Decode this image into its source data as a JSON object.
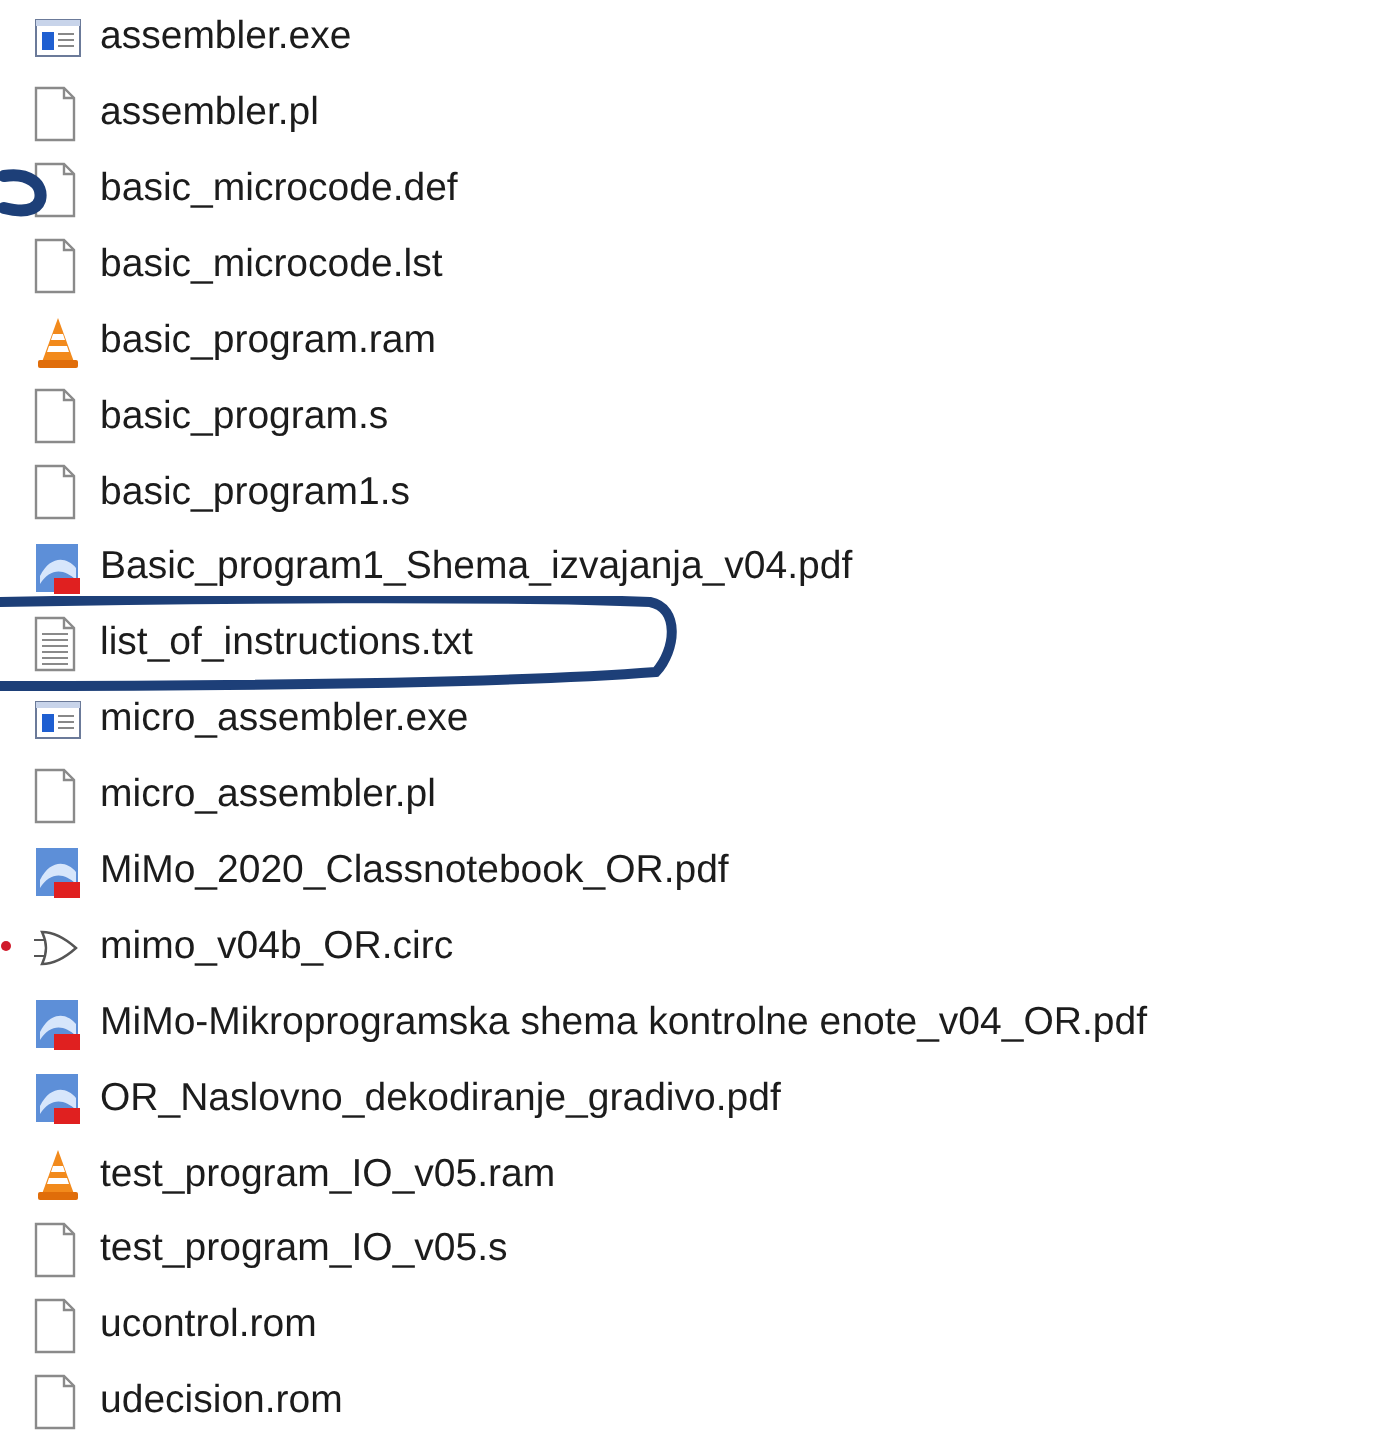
{
  "files": [
    {
      "name": "assembler.exe",
      "kind": "exe"
    },
    {
      "name": "assembler.pl",
      "kind": "file"
    },
    {
      "name": "basic_microcode.def",
      "kind": "file"
    },
    {
      "name": "basic_microcode.lst",
      "kind": "file"
    },
    {
      "name": "basic_program.ram",
      "kind": "vlc"
    },
    {
      "name": "basic_program.s",
      "kind": "file"
    },
    {
      "name": "basic_program1.s",
      "kind": "file"
    },
    {
      "name": "Basic_program1_Shema_izvajanja_v04.pdf",
      "kind": "pdf"
    },
    {
      "name": "list_of_instructions.txt",
      "kind": "text"
    },
    {
      "name": "micro_assembler.exe",
      "kind": "exe"
    },
    {
      "name": "micro_assembler.pl",
      "kind": "file"
    },
    {
      "name": "MiMo_2020_Classnotebook_OR.pdf",
      "kind": "pdf"
    },
    {
      "name": "mimo_v04b_OR.circ",
      "kind": "circ"
    },
    {
      "name": "MiMo-Mikroprogramska shema kontrolne enote_v04_OR.pdf",
      "kind": "pdf"
    },
    {
      "name": "OR_Naslovno_dekodiranje_gradivo.pdf",
      "kind": "pdf"
    },
    {
      "name": "test_program_IO_v05.ram",
      "kind": "vlc"
    },
    {
      "name": "test_program_IO_v05.s",
      "kind": "file"
    },
    {
      "name": "ucontrol.rom",
      "kind": "file"
    },
    {
      "name": "udecision.rom",
      "kind": "file"
    }
  ]
}
